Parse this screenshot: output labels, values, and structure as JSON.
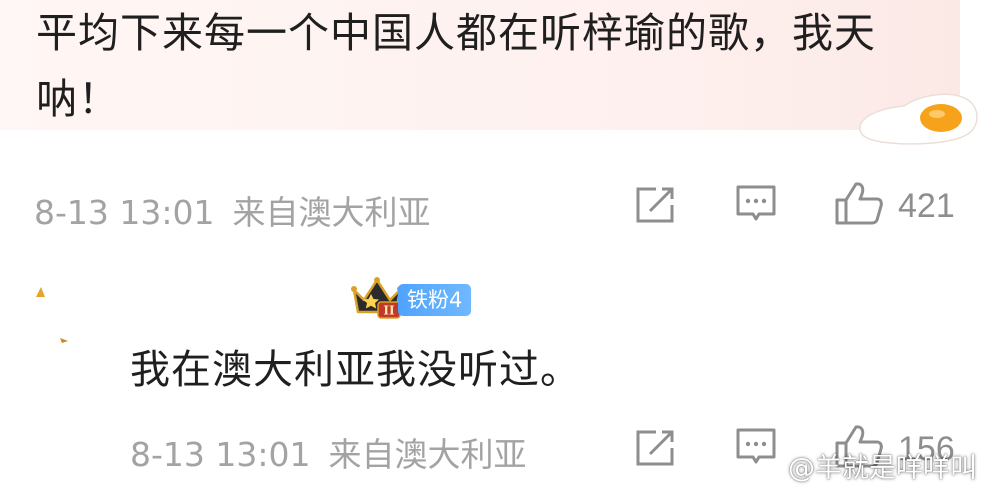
{
  "comment": {
    "text": "平均下来每一个中国人都在听梓瑜的歌，我天呐！",
    "time": "8-13 13:01",
    "location": "来自澳大利亚",
    "like_count": "421",
    "icons": [
      "share-icon",
      "reply-icon",
      "like-icon"
    ]
  },
  "reply": {
    "badge_label": "铁粉4",
    "crown_level": "II",
    "text": "我在澳大利亚我没听过。",
    "time": "8-13 13:01",
    "location": "来自澳大利亚",
    "like_count": "156",
    "icons": [
      "share-icon",
      "reply-icon",
      "like-icon"
    ]
  },
  "watermark": "@羊就是咩咩叫",
  "colors": {
    "bubble": "#fef0ee",
    "meta_text": "#a3a3a3",
    "badge": "#5aa9ff",
    "egg_yolk": "#f5a623"
  }
}
